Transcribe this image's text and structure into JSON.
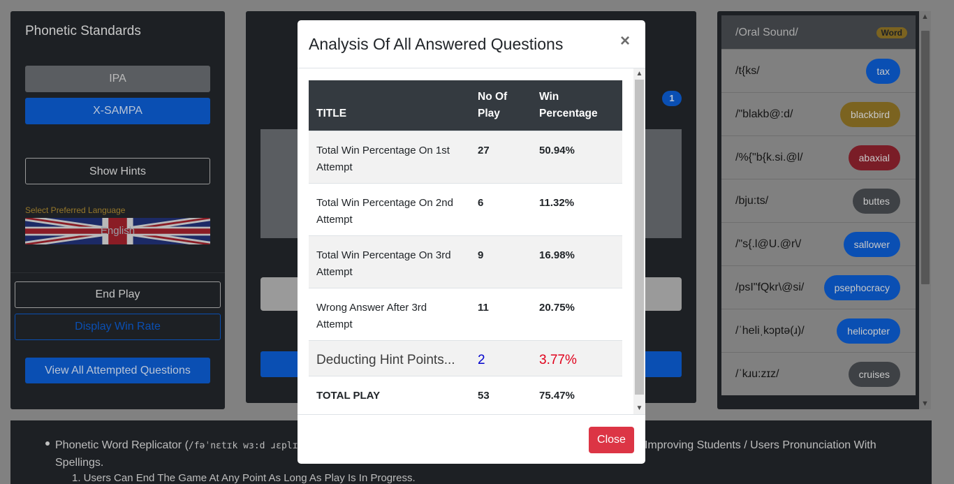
{
  "sidebar": {
    "title": "Phonetic Standards",
    "ipa_label": "IPA",
    "xsampa_label": "X-SAMPA",
    "show_hints_label": "Show Hints",
    "language_label": "Select Preferred Language",
    "language_value": "English",
    "end_play_label": "End Play",
    "display_win_rate_label": "Display Win Rate",
    "view_all_label": "View All Attempted Questions"
  },
  "center": {
    "badge": "1"
  },
  "word_list": {
    "header_sound": "/Oral Sound/",
    "header_tag": "Word",
    "items": [
      {
        "sound": "/t{ks/",
        "word": "tax",
        "color": "#0a4fb3"
      },
      {
        "sound": "/\"blakb@:d/",
        "word": "blackbird",
        "color": "#7b6320"
      },
      {
        "sound": "/%{\"b{k.si.@l/",
        "word": "abaxial",
        "color": "#7a1d27"
      },
      {
        "sound": "/bju:ts/",
        "word": "buttes",
        "color": "#3e4145"
      },
      {
        "sound": "/\"s{.l@U.@r\\/",
        "word": "sallower",
        "color": "#0a4fb3"
      },
      {
        "sound": "/psI\"fQkr\\@si/",
        "word": "psephocracy",
        "color": "#0a4fb3"
      },
      {
        "sound": "/ˈheliˌkɔptə(ɹ)/",
        "word": "helicopter",
        "color": "#0a4fb3"
      },
      {
        "sound": "/ˈkɹu:zɪz/",
        "word": "cruises",
        "color": "#3e4145"
      }
    ]
  },
  "footer": {
    "lead": "Phonetic Word Replicator (",
    "ipa": "/fəˈnɛtɪk wɜ:d ɹɛplɪ",
    "tail": "Aimed At Improving Students / Users Pronunciation With Spellings.",
    "sub_item": "1. Users Can End The Game At Any Point As Long As Play Is In Progress."
  },
  "modal": {
    "title": "Analysis Of All Answered Questions",
    "close_x": "×",
    "close_label": "Close",
    "table": {
      "headers": [
        "TITLE",
        "No Of Play",
        "Win Percentage"
      ],
      "rows": [
        {
          "title": "Total Win Percentage On 1st Attempt",
          "plays": "27",
          "pct": "50.94%"
        },
        {
          "title": "Total Win Percentage On 2nd Attempt",
          "plays": "6",
          "pct": "11.32%"
        },
        {
          "title": "Total Win Percentage On 3rd Attempt",
          "plays": "9",
          "pct": "16.98%"
        },
        {
          "title": "Wrong Answer After 3rd Attempt",
          "plays": "11",
          "pct": "20.75%"
        }
      ],
      "hint_row": {
        "title": "Deducting Hint Points...",
        "plays": "2",
        "pct": "3.77%"
      },
      "total_row": {
        "title": "TOTAL PLAY",
        "plays": "53",
        "pct": "75.47%"
      }
    }
  },
  "colors": {
    "primary": "#0d6efd",
    "danger": "#dc3545",
    "table_header": "#343a40",
    "value_blue": "#0000cc",
    "hint_red": "#e0001b"
  }
}
